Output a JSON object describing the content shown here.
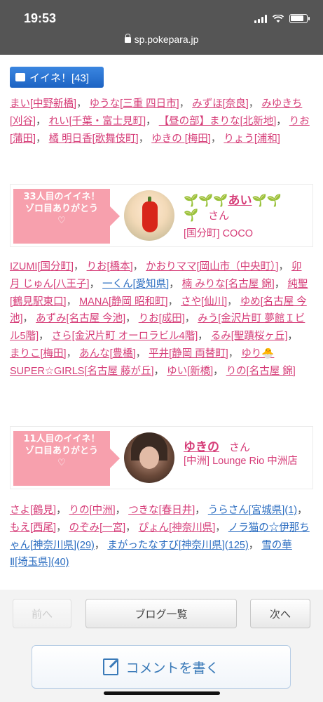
{
  "status": {
    "time": "19:53",
    "url": "sp.pokepara.jp"
  },
  "like_button": {
    "label": "イイネ！[43]"
  },
  "names_block_1": [
    "まい[中野新橋]",
    "ゆうな[三重 四日市]",
    "みずほ[奈良]",
    "みゆきち[刈谷]",
    "れい[千葉・富士見町]",
    "【昼の部】まりな[北新地]",
    "りお[蒲田]",
    "橘 明日香[歌舞伎町]",
    "ゆきの [梅田]",
    "りょう[浦和]"
  ],
  "card_1": {
    "banner_line1": "33人目のイイネ！",
    "banner_line2": "ゾロ目ありがとう",
    "heart": "♡",
    "name_prefix": "🌱🌱🌱",
    "name": "あい",
    "name_suffix": "🌱🌱",
    "name_extra": "🌱",
    "san": "さん",
    "shop": "[国分町] COCO"
  },
  "names_block_2": [
    "IZUMI[国分町]",
    "りお[橋本]",
    "かおりママ[岡山市（中央町）]",
    "卯月 じゅん[八王子]",
    "一くん[愛知県]",
    "楠 みりな[名古屋 錦]",
    "純聖[鶴見駅東口]",
    "MANA[静岡 昭和町]",
    "さや[仙川]",
    "ゆめ[名古屋 今池]",
    "あずみ[名古屋 今池]",
    "りお[成田]",
    "みう[金沢片町 夢館Ｉビル5階]",
    "さら[金沢片町 オーロラビル4階]",
    "るみ[聖蹟桜ヶ丘]",
    "まりこ[梅田]",
    "あんな[豊橋]",
    "平井[静岡 両替町]",
    "ゆり🐣SUPER☆GIRLS[名古屋 藤が丘]",
    "ゆい[新橋]",
    "りの[名古屋 錦]"
  ],
  "card_2": {
    "banner_line1": "11人目のイイネ！",
    "banner_line2": "ゾロ目ありがとう",
    "heart": "♡",
    "name": "ゆきの",
    "san": "さん",
    "shop": "[中洲] Lounge Rio 中洲店"
  },
  "names_block_3": [
    "さよ[鶴見]",
    "りの[中洲]",
    "つきな[春日井]",
    "うらさん[宮城県](1)",
    "もえ[西尾]",
    "のぞみ[一宮]",
    "ぴょん[神奈川県]",
    "ノラ猫の☆伊那ちゃん[神奈川県](29)",
    "まがったなすび[神奈川県](125)",
    "雪の華Ⅱ[埼玉県](40)"
  ],
  "nav": {
    "prev": "前へ",
    "list": "ブログ一覧",
    "next": "次へ"
  },
  "comment_button": {
    "label": "コメントを書く"
  },
  "colors": {
    "pink_link": "#d63d78",
    "blue_link": "#2a6cc0",
    "banner": "#f7a0ad",
    "button_blue": "#1d63c3"
  }
}
